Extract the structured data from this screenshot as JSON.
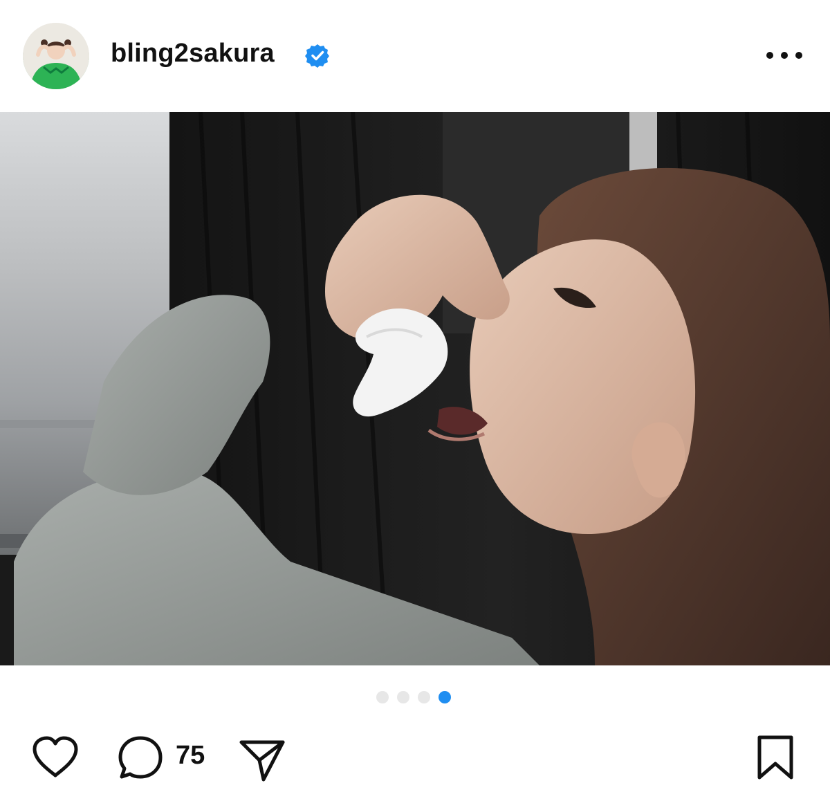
{
  "post": {
    "username": "bling2sakura",
    "verified": true,
    "verified_icon": "verified-badge-icon",
    "more_icon": "more-options-icon",
    "avatar_description_icon": "profile-avatar",
    "carousel": {
      "total": 4,
      "active_index": 4
    },
    "actions": {
      "like_icon": "heart-icon",
      "comment_icon": "comment-bubble-icon",
      "comment_count": "75",
      "share_icon": "send-icon",
      "save_icon": "bookmark-icon"
    },
    "colors": {
      "text": "#111111",
      "verified_blue": "#1f8ef1",
      "dot_active": "#1f8ef1",
      "dot_inactive": "#e7e7e7"
    }
  }
}
